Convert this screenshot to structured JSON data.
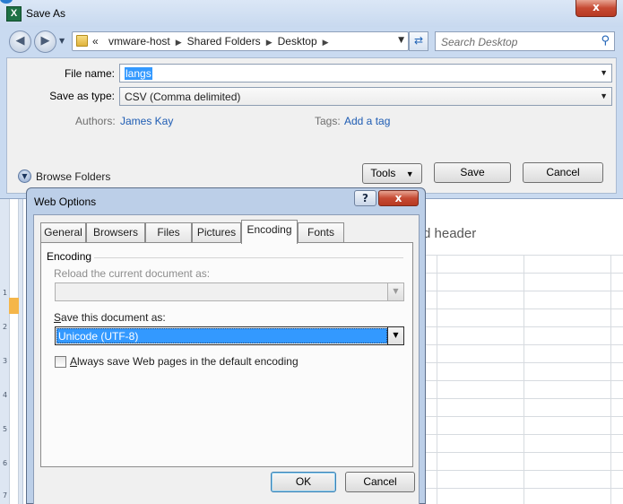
{
  "sheet": {
    "header_fragment": "d header",
    "ruler_numbers": [
      "1",
      "2",
      "3",
      "4",
      "5",
      "6",
      "7"
    ]
  },
  "save_as": {
    "title": "Save As",
    "app_icon_letter": "X",
    "close_label": "x",
    "breadcrumbs": [
      "«",
      "vmware-host",
      "Shared Folders",
      "Desktop"
    ],
    "search_placeholder": "Search Desktop",
    "file_name_label": "File name:",
    "file_name_value": "langs",
    "save_type_label": "Save as type:",
    "save_type_value": "CSV (Comma delimited)",
    "authors_label": "Authors:",
    "authors_value": "James Kay",
    "tags_label": "Tags:",
    "tags_value": "Add a tag",
    "browse_label": "Browse Folders",
    "tools_label": "Tools",
    "save_label": "Save",
    "cancel_label": "Cancel"
  },
  "web_options": {
    "title": "Web Options",
    "help_label": "?",
    "close_label": "x",
    "tabs": [
      "General",
      "Browsers",
      "Files",
      "Pictures",
      "Encoding",
      "Fonts"
    ],
    "active_tab": "Encoding",
    "group_label": "Encoding",
    "reload_label": "Reload the current document as:",
    "reload_value": "",
    "save_doc_label_first": "S",
    "save_doc_label_rest": "ave this document as:",
    "save_doc_value": "Unicode (UTF-8)",
    "checkbox_label_first": "A",
    "checkbox_label_rest": "lways save Web pages in the default encoding",
    "checkbox_checked": false,
    "ok_label": "OK",
    "cancel_label": "Cancel"
  },
  "colors": {
    "accent": "#3399ff",
    "link": "#1e5cb3",
    "close_red": "#c64a33"
  }
}
